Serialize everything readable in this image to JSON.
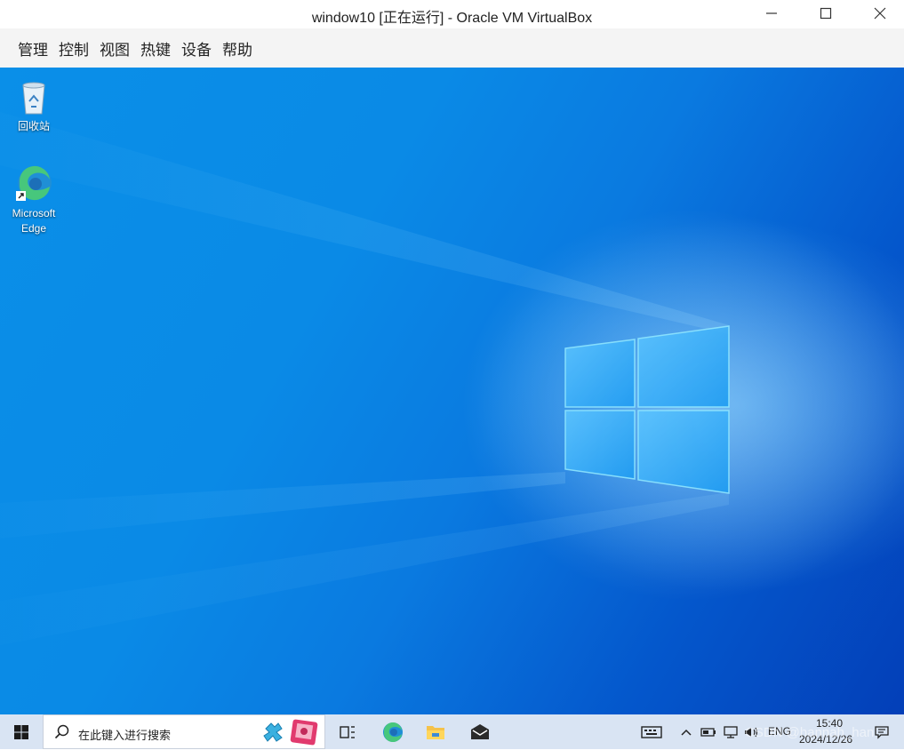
{
  "window": {
    "title": "window10 [正在运行] - Oracle VM VirtualBox"
  },
  "menu": {
    "items": [
      "管理",
      "控制",
      "视图",
      "热键",
      "设备",
      "帮助"
    ]
  },
  "desktop": {
    "icons": [
      {
        "label": "回收站",
        "icon": "recycle-bin-icon"
      },
      {
        "label": "Microsoft Edge",
        "line1": "Microsoft",
        "line2": "Edge",
        "icon": "edge-icon"
      }
    ]
  },
  "taskbar": {
    "search_placeholder": "在此键入进行搜索",
    "pinned": [
      "task-view-icon",
      "edge-icon",
      "file-explorer-icon",
      "mail-icon"
    ],
    "tray": {
      "language": "ENG",
      "time": "15:40",
      "date": "2024/12/26"
    }
  },
  "watermark": "CSDN @hannah_han",
  "colors": {
    "desktop_light": "#0a8fe8",
    "desktop_dark": "#033fb8",
    "taskbar": "#d9e4f3"
  }
}
